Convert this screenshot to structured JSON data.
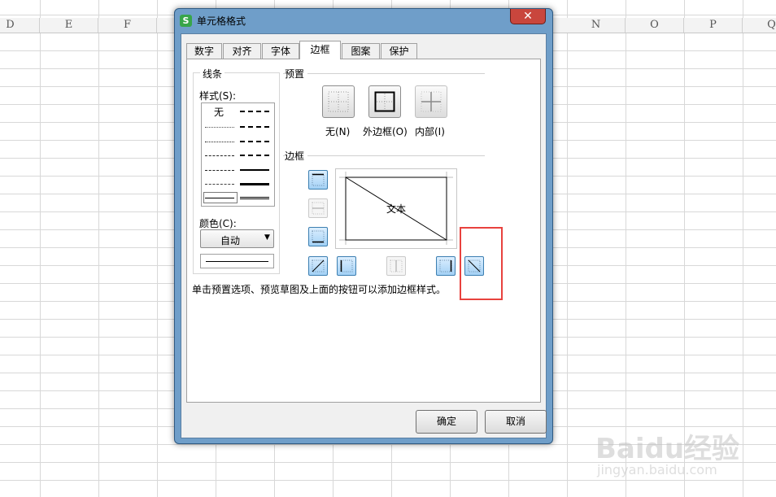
{
  "spreadsheet": {
    "columns": [
      "D",
      "E",
      "F",
      "N",
      "O",
      "P",
      "Q"
    ]
  },
  "dialog": {
    "title": "单元格格式",
    "app_icon": "S",
    "close_glyph": "✕",
    "tabs": [
      {
        "label": "数字"
      },
      {
        "label": "对齐"
      },
      {
        "label": "字体"
      },
      {
        "label": "边框"
      },
      {
        "label": "图案"
      },
      {
        "label": "保护"
      }
    ],
    "active_tab": "边框",
    "lines": {
      "legend": "线条",
      "style_label": "样式(S):",
      "none_label": "无",
      "color_label": "颜色(C):",
      "color_value": "自动",
      "dropdown_glyph": "▼"
    },
    "presets": {
      "title": "预置",
      "items": [
        {
          "label": "无(N)"
        },
        {
          "label": "外边框(O)"
        },
        {
          "label": "内部(I)"
        }
      ]
    },
    "border": {
      "title": "边框",
      "preview_text": "文本"
    },
    "hint": "单击预置选项、预览草图及上面的按钮可以添加边框样式。",
    "buttons": {
      "ok": "确定",
      "cancel": "取消"
    }
  },
  "watermark": {
    "logo": "Baidu经验",
    "url": "jingyan.baidu.com"
  },
  "colors": {
    "highlight": "#e8423e",
    "title_bar": "#6f9ec9",
    "close_button": "#c9463d"
  }
}
